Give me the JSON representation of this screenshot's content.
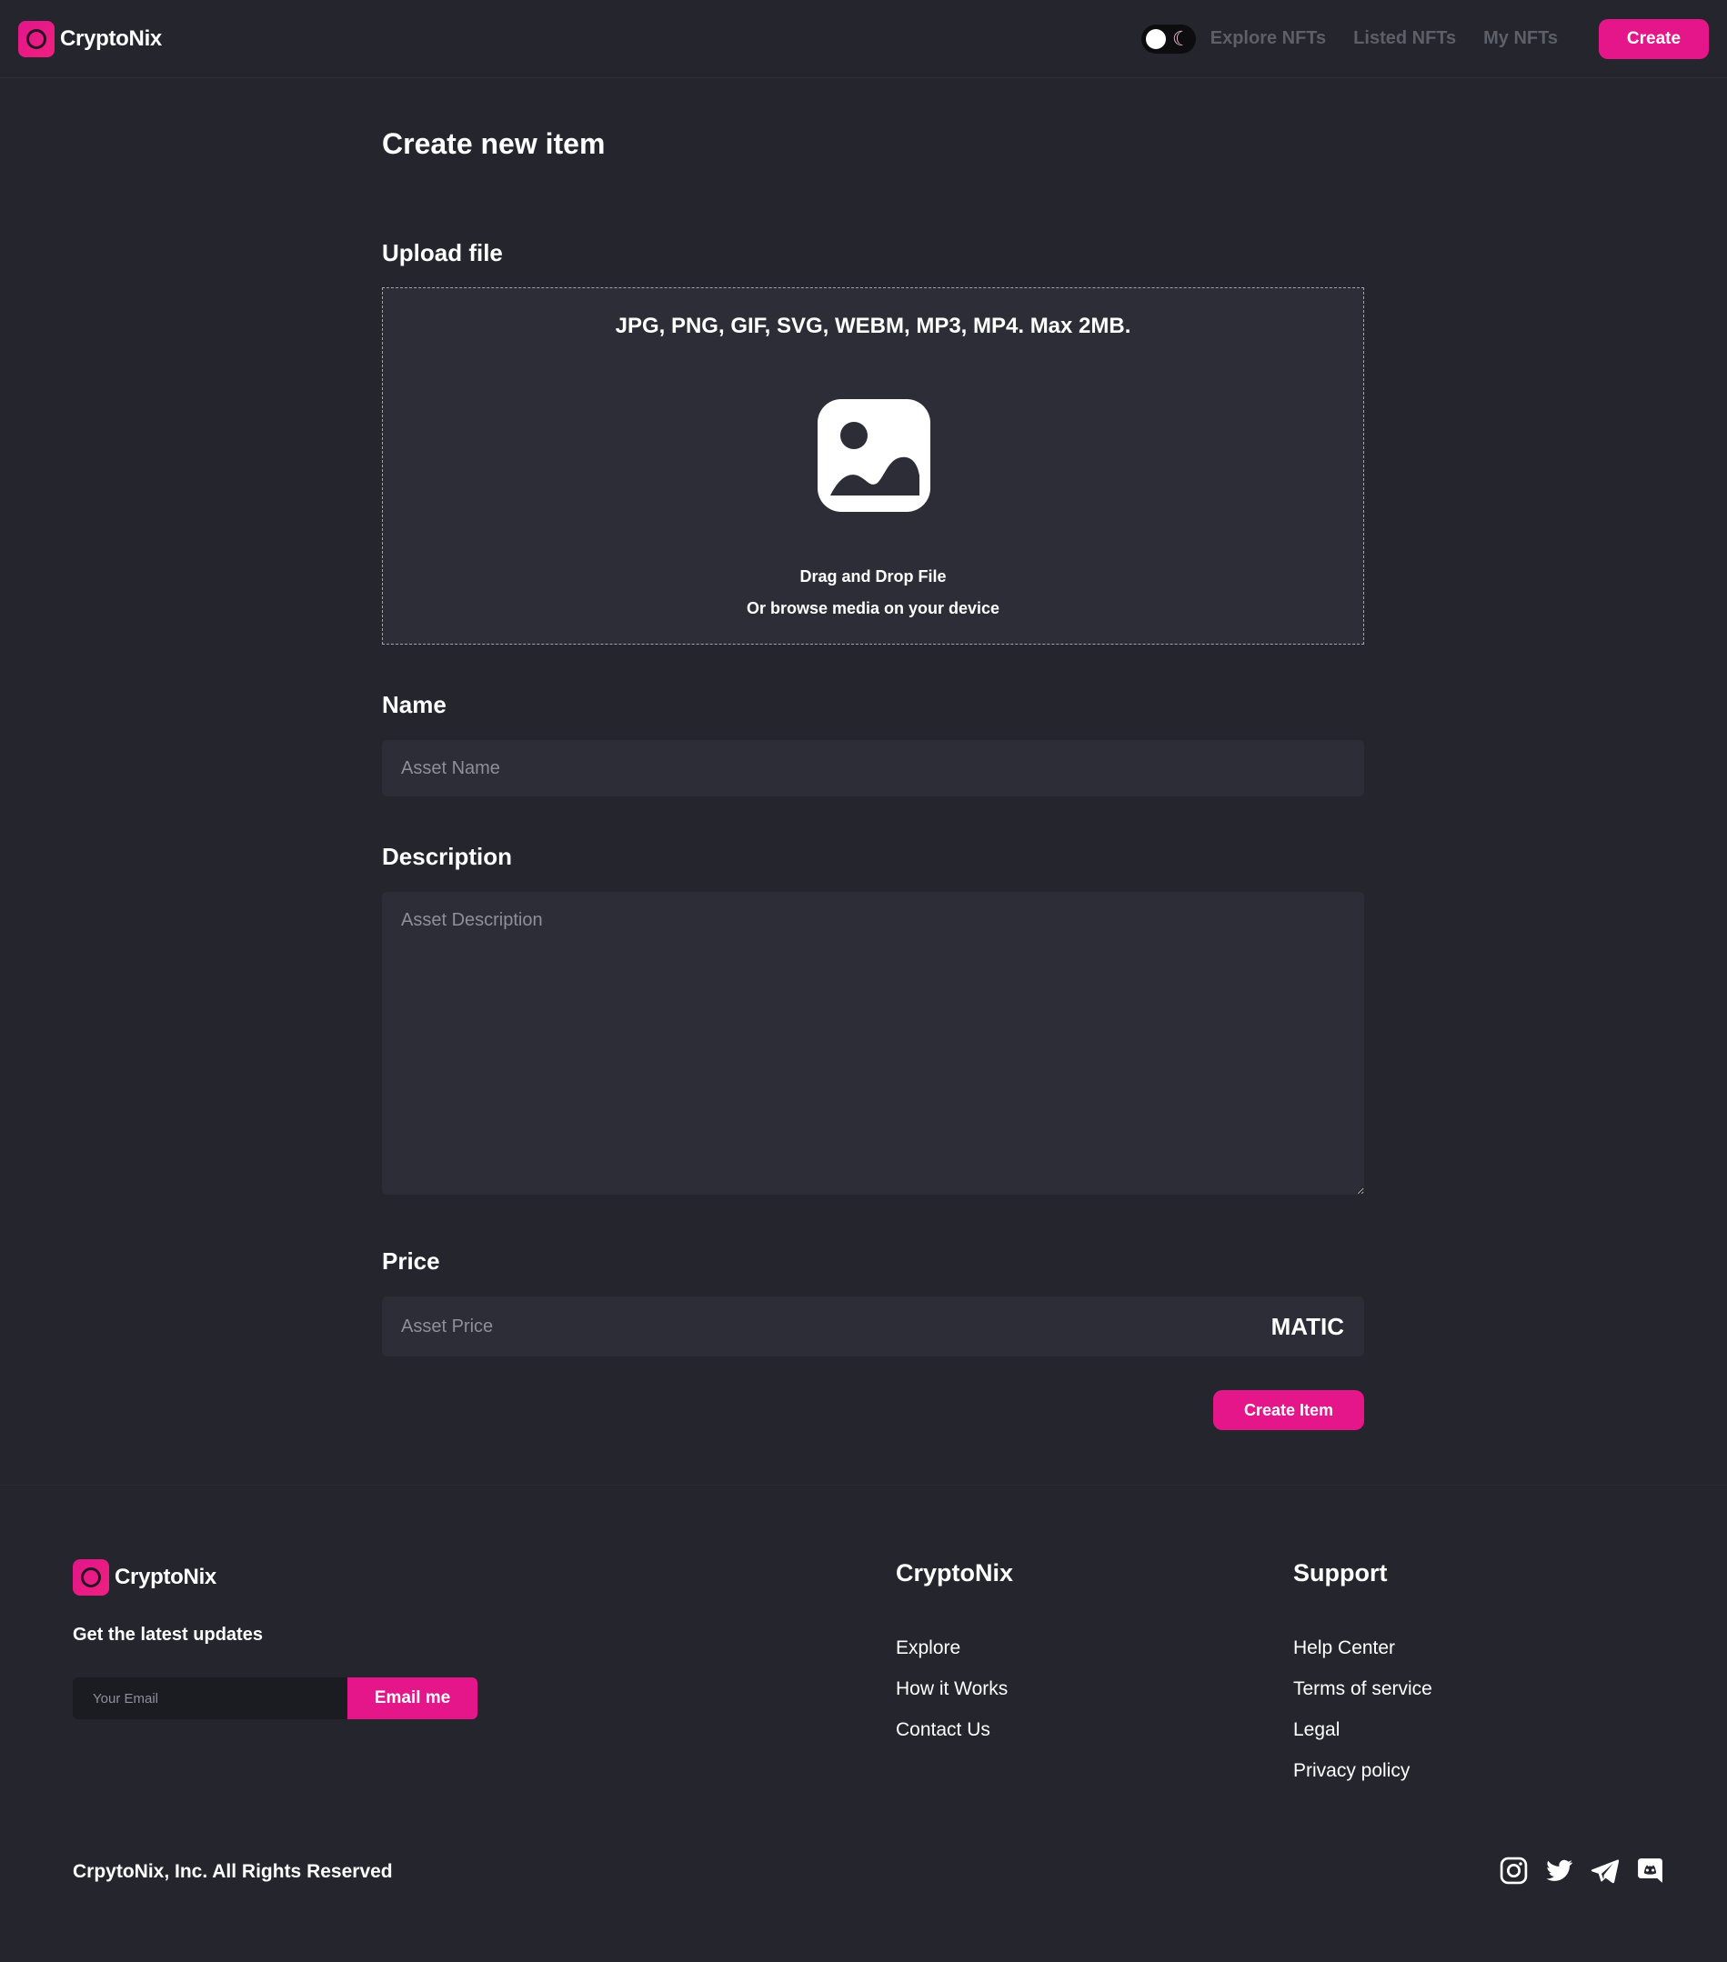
{
  "navbar": {
    "brand": "CryptoNix",
    "links": [
      "Explore NFTs",
      "Listed NFTs",
      "My NFTs"
    ],
    "create_label": "Create",
    "theme_toggle_icon": "moon-icon"
  },
  "form": {
    "title": "Create new item",
    "upload": {
      "label": "Upload file",
      "formats": "JPG, PNG, GIF, SVG, WEBM, MP3, MP4. Max 2MB.",
      "icon": "image-icon",
      "drag_text": "Drag and Drop File",
      "browse_text": "Or browse media on your device"
    },
    "name": {
      "label": "Name",
      "placeholder": "Asset Name",
      "value": ""
    },
    "description": {
      "label": "Description",
      "placeholder": "Asset Description",
      "value": ""
    },
    "price": {
      "label": "Price",
      "placeholder": "Asset Price",
      "value": "",
      "currency": "MATIC"
    },
    "submit_label": "Create Item"
  },
  "footer": {
    "brand": "CryptoNix",
    "updates_title": "Get the latest updates",
    "email_placeholder": "Your Email",
    "email_button": "Email me",
    "columns": [
      {
        "title": "CryptoNix",
        "links": [
          "Explore",
          "How it Works",
          "Contact Us"
        ]
      },
      {
        "title": "Support",
        "links": [
          "Help Center",
          "Terms of service",
          "Legal",
          "Privacy policy"
        ]
      }
    ],
    "copyright": "CrpytoNix, Inc. All Rights Reserved",
    "socials": [
      "instagram-icon",
      "twitter-icon",
      "telegram-icon",
      "discord-icon"
    ]
  },
  "colors": {
    "background": "#24252d",
    "surface": "#2c2d36",
    "accent": "#e5168a",
    "muted_text": "#5d5f69"
  }
}
